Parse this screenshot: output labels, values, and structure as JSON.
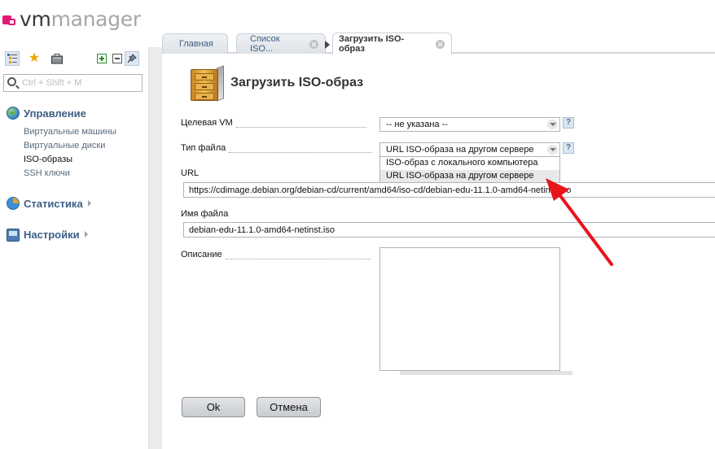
{
  "logo": {
    "part1": "vm",
    "part2": "manager"
  },
  "colors": {
    "accent": "#3d5e85",
    "logo_mark": "#e3187a",
    "annotation_arrow": "#e8141c"
  },
  "toolbar": {
    "icons": [
      "tree-list-icon",
      "star-icon",
      "briefcase-icon",
      "expand-all-icon",
      "collapse-all-icon",
      "pin-icon"
    ]
  },
  "search": {
    "placeholder": "Ctrl + Shift + M",
    "value": ""
  },
  "sidebar": {
    "groups": [
      {
        "label": "Управление",
        "icon": "globe-icon",
        "items": [
          "Виртуальные машины",
          "Виртуальные диски",
          "ISO-образы",
          "SSH ключи"
        ]
      },
      {
        "label": "Статистика",
        "icon": "pie-chart-icon"
      },
      {
        "label": "Настройки",
        "icon": "monitor-icon"
      }
    ],
    "active_item": "ISO-образы"
  },
  "tabs": [
    {
      "label": "Главная"
    },
    {
      "label": "Список ISO..."
    },
    {
      "label": "Загрузить ISO-образ"
    }
  ],
  "form": {
    "title": "Загрузить ISO-образ",
    "icon": "file-cabinet-icon",
    "fields": {
      "target_vm": {
        "label": "Целевая VM",
        "value": "-- не указана --"
      },
      "file_type": {
        "label": "Тип файла",
        "value": "URL ISO-образа на другом сервере",
        "options": [
          "ISO-образ с локального компьютера",
          "URL ISO-образа на другом сервере"
        ],
        "highlighted_option": "URL ISO-образа на другом сервере"
      },
      "url": {
        "label": "URL",
        "value": "https://cdimage.debian.org/debian-cd/current/amd64/iso-cd/debian-edu-11.1.0-amd64-netinst.iso"
      },
      "file_name": {
        "label": "Имя файла",
        "value": "debian-edu-11.1.0-amd64-netinst.iso"
      },
      "description": {
        "label": "Описание",
        "value": ""
      }
    },
    "help_mark": "?",
    "buttons": {
      "ok": "Ok",
      "cancel": "Отмена"
    }
  }
}
